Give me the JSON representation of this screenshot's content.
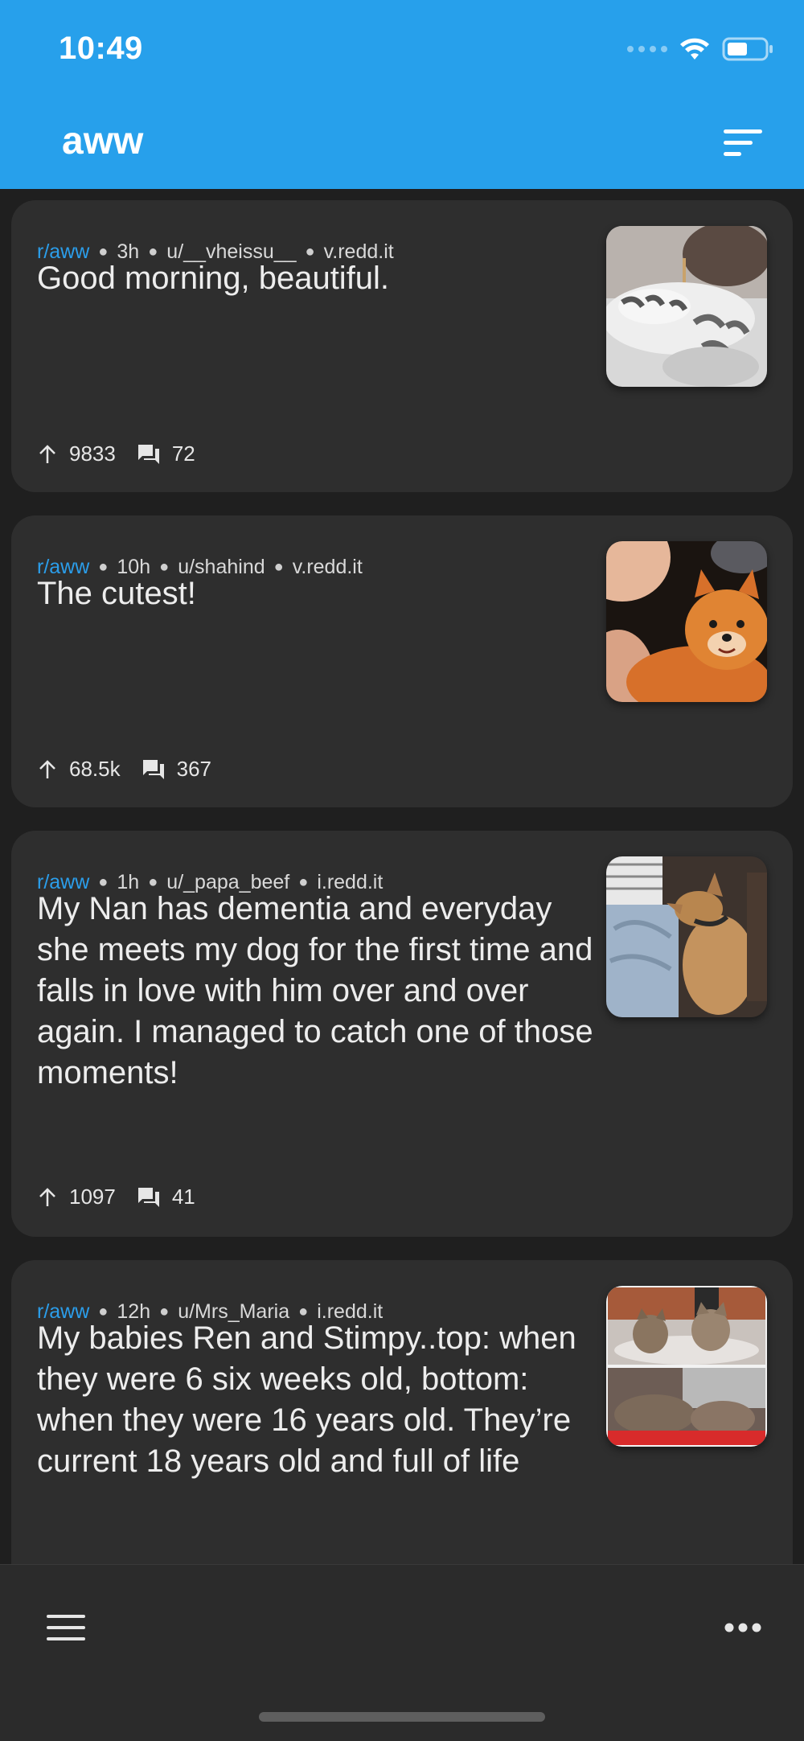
{
  "status_bar": {
    "time": "10:49"
  },
  "header": {
    "title": "aww"
  },
  "posts": [
    {
      "subreddit": "r/aww",
      "age": "3h",
      "author": "u/__vheissu__",
      "domain": "v.redd.it",
      "title": "Good morning, beautiful.",
      "upvotes": "9833",
      "comments": "72",
      "thumbnail": "cat-paws-thumbnail"
    },
    {
      "subreddit": "r/aww",
      "age": "10h",
      "author": "u/shahind",
      "domain": "v.redd.it",
      "title": "The cutest!",
      "upvotes": "68.5k",
      "comments": "367",
      "thumbnail": "pomeranian-thumbnail"
    },
    {
      "subreddit": "r/aww",
      "age": "1h",
      "author": "u/_papa_beef",
      "domain": "i.redd.it",
      "title": "My Nan has dementia and everyday she meets my dog for the first time and falls in love with him over and over again. I managed to catch one of those moments!",
      "upvotes": "1097",
      "comments": "41",
      "thumbnail": "dog-with-nan-thumbnail"
    },
    {
      "subreddit": "r/aww",
      "age": "12h",
      "author": "u/Mrs_Maria",
      "domain": "i.redd.it",
      "title": "My babies Ren and Stimpy..top: when they were 6 six weeks old, bottom: when they were 16 years old. They’re current 18 years old and full of life",
      "upvotes": "",
      "comments": "",
      "thumbnail": "two-cats-collage-thumbnail"
    }
  ],
  "colors": {
    "header": "#27a0eb",
    "card": "#2e2e2e",
    "background": "#1f1f1f",
    "subreddit": "#2b9eeb"
  },
  "icons": {
    "sort": "sort-icon",
    "upvote": "arrow-up-icon",
    "comments": "comment-icon",
    "menu": "hamburger-menu-icon",
    "more": "more-horizontal-icon"
  }
}
